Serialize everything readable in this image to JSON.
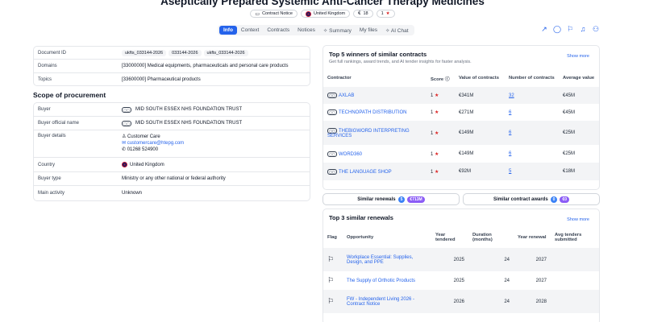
{
  "page": {
    "title": "Aseptically Prepared Systemic Anti-Cancer Therapy Medicines",
    "badges": {
      "notice_type": "Contract Notice",
      "country": "United Kingdom",
      "currency_count": "18",
      "score": "1"
    }
  },
  "tabs": [
    {
      "label": "Info",
      "active": true
    },
    {
      "label": "Context"
    },
    {
      "label": "Contracts"
    },
    {
      "label": "Notices"
    },
    {
      "label": "Summary",
      "icon": "sparkle-icon"
    },
    {
      "label": "My files"
    },
    {
      "label": "AI Chat",
      "icon": "sparkle-icon"
    }
  ],
  "actions": [
    {
      "name": "share-icon",
      "glyph": "↗"
    },
    {
      "name": "comment-icon",
      "glyph": "◯"
    },
    {
      "name": "flag-icon",
      "glyph": "⚐"
    },
    {
      "name": "bell-icon",
      "glyph": "♫"
    },
    {
      "name": "add-user-icon",
      "glyph": "⚇"
    }
  ],
  "info": {
    "document_id_label": "Document ID",
    "document_ids": [
      "ukfts_033144-2026",
      "033144-2026",
      "ukfts_033144-2026"
    ],
    "domains_label": "Domains",
    "domains_value": "[33000000] Medical equipments, pharmaceuticals and personal care products",
    "topics_label": "Topics",
    "topics_value": "[33600000] Pharmaceutical products"
  },
  "scope": {
    "section_title": "Scope of procurement",
    "buyer_label": "Buyer",
    "buyer_value": "MID SOUTH ESSEX NHS FOUNDATION TRUST",
    "buyer_official_label": "Buyer official name",
    "buyer_official_value": "MID SOUTH ESSEX NHS FOUNDATION TRUST",
    "buyer_details_label": "Buyer details",
    "contact_name": "Customer Care",
    "contact_email": "customercare@htepg.com",
    "contact_phone": "01268 524900",
    "country_label": "Country",
    "country_value": "United Kingdom",
    "buyer_type_label": "Buyer type",
    "buyer_type_value": "Ministry or any other national or federal authority",
    "main_activity_label": "Main activity",
    "main_activity_value": "Unknown"
  },
  "winners": {
    "title": "Top 5 winners of similar contracts",
    "subtitle": "Get full rankings, award trends, and AI tender insights for faster analysis.",
    "show_more": "Show more",
    "columns": [
      "Contractor",
      "Score",
      "Value of contracts",
      "Number of contracts",
      "Average value"
    ],
    "rows": [
      {
        "name": "AXLAB",
        "score": "1",
        "value": "€341M",
        "count": "32",
        "avg": "€45M"
      },
      {
        "name": "TECHNOPATH DISTRIBUTION",
        "score": "1",
        "value": "€271M",
        "count": "6",
        "avg": "€45M"
      },
      {
        "name": "THEBIGWORD INTERPRETING SERVICES",
        "score": "1",
        "value": "€149M",
        "count": "6",
        "avg": "€25M"
      },
      {
        "name": "WORD360",
        "score": "1",
        "value": "€149M",
        "count": "6",
        "avg": "€25M"
      },
      {
        "name": "THE LANGUAGE SHOP",
        "score": "1",
        "value": "€92M",
        "count": "5",
        "avg": "€18M"
      }
    ]
  },
  "similar": {
    "renewals_label": "Similar renewals",
    "renewals_count": "5",
    "renewals_value": "€713M",
    "awards_label": "Similar contract awards",
    "awards_count": "0",
    "awards_value": "€0"
  },
  "renewals": {
    "title": "Top 3 similar renewals",
    "show_more": "Show more",
    "columns": [
      "Flag",
      "Opportunity",
      "Year tendered",
      "Duration (months)",
      "Year renewal",
      "Avg tenders submitted"
    ],
    "rows": [
      {
        "opportunity": "Workplace Essential: Supplies, Design, and PPE",
        "year": "2025",
        "duration": "24",
        "renewal": "2027",
        "avg": ""
      },
      {
        "opportunity": "The Supply of Orthotic Products",
        "year": "2025",
        "duration": "24",
        "renewal": "2027",
        "avg": ""
      },
      {
        "opportunity": "FW - Independent Living 2026 - Contract Notice",
        "year": "2026",
        "duration": "24",
        "renewal": "2028",
        "avg": ""
      }
    ]
  }
}
